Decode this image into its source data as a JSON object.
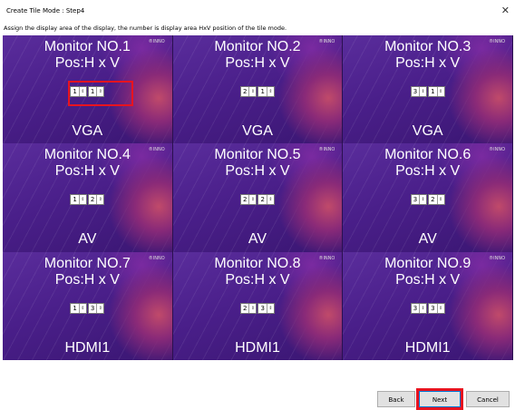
{
  "window": {
    "title": "Create Tile Mode : Step4",
    "close_icon": "✕"
  },
  "instruction": "Assign the display area of the display, the number is display area HxV position of the tile mode.",
  "monitors": [
    {
      "name": "Monitor NO.1",
      "pos": "Pos:H x V",
      "h": "1",
      "v": "1",
      "source": "VGA"
    },
    {
      "name": "Monitor NO.2",
      "pos": "Pos:H x V",
      "h": "2",
      "v": "1",
      "source": "VGA"
    },
    {
      "name": "Monitor NO.3",
      "pos": "Pos:H x V",
      "h": "3",
      "v": "1",
      "source": "VGA"
    },
    {
      "name": "Monitor NO.4",
      "pos": "Pos:H x V",
      "h": "1",
      "v": "2",
      "source": "AV"
    },
    {
      "name": "Monitor NO.5",
      "pos": "Pos:H x V",
      "h": "2",
      "v": "2",
      "source": "AV"
    },
    {
      "name": "Monitor NO.6",
      "pos": "Pos:H x V",
      "h": "3",
      "v": "2",
      "source": "AV"
    },
    {
      "name": "Monitor NO.7",
      "pos": "Pos:H x V",
      "h": "1",
      "v": "3",
      "source": "HDMI1"
    },
    {
      "name": "Monitor NO.8",
      "pos": "Pos:H x V",
      "h": "2",
      "v": "3",
      "source": "HDMI1"
    },
    {
      "name": "Monitor NO.9",
      "pos": "Pos:H x V",
      "h": "3",
      "v": "3",
      "source": "HDMI1"
    }
  ],
  "buttons": {
    "back": "Back",
    "next": "Next",
    "cancel": "Cancel"
  },
  "colors": {
    "highlight": "#e8131f",
    "tile_bg": "#4a1f8a"
  }
}
